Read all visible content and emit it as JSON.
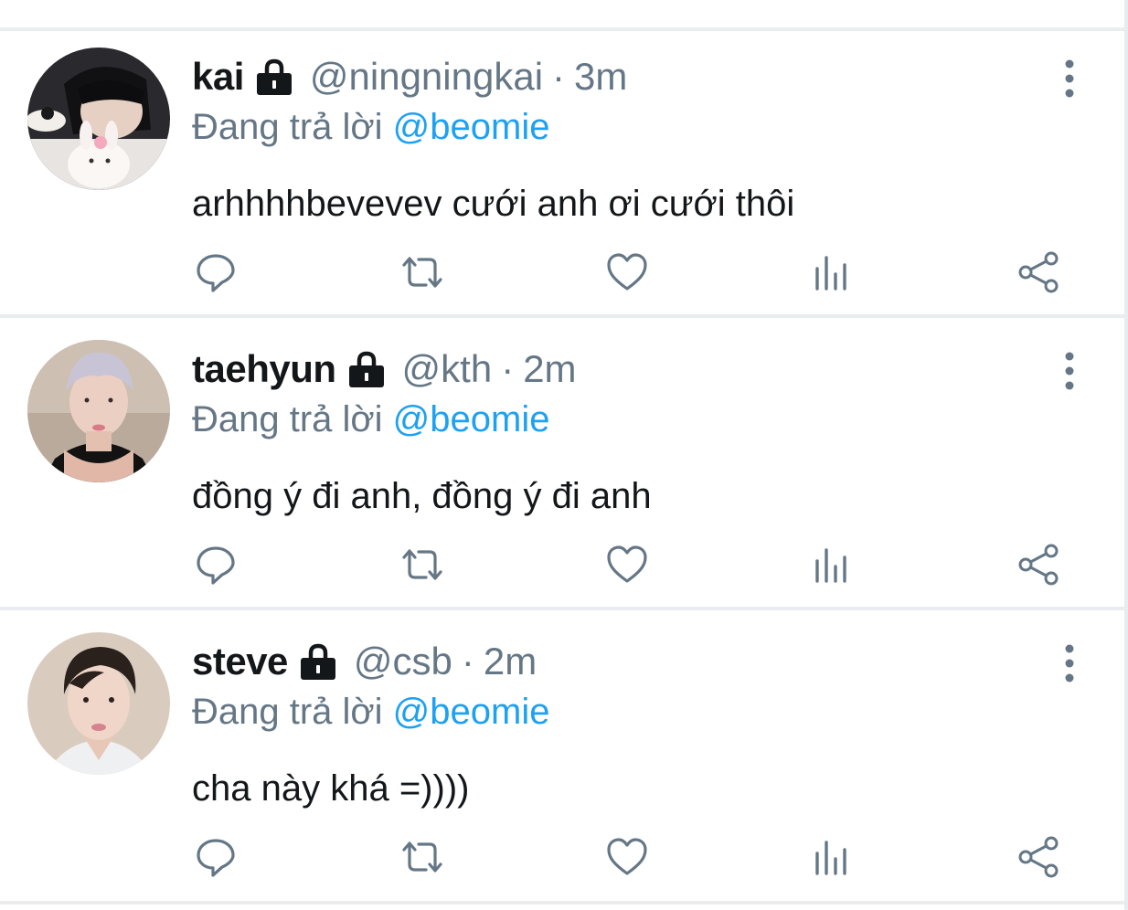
{
  "colors": {
    "text_primary": "#14171a",
    "text_secondary": "#657786",
    "mention": "#1da1f2",
    "divider": "#e9edf0"
  },
  "tweets": [
    {
      "name": "kai",
      "handle": "@ningningkai",
      "separator": "·",
      "time": "3m",
      "reply_prefix": "Đang trả lời",
      "reply_to": "@beomie",
      "text": "arhhhhbevevev cưới anh ơi cưới thôi",
      "protected_icon": "lock-icon",
      "menu_icon": "more-vertical-icon",
      "actions": [
        "reply-icon",
        "retweet-icon",
        "like-icon",
        "analytics-icon",
        "share-icon"
      ]
    },
    {
      "name": "taehyun",
      "handle": "@kth",
      "separator": "·",
      "time": "2m",
      "reply_prefix": "Đang trả lời",
      "reply_to": "@beomie",
      "text": "đồng ý đi anh, đồng ý đi anh",
      "protected_icon": "lock-icon",
      "menu_icon": "more-vertical-icon",
      "actions": [
        "reply-icon",
        "retweet-icon",
        "like-icon",
        "analytics-icon",
        "share-icon"
      ]
    },
    {
      "name": "steve",
      "handle": "@csb",
      "separator": "·",
      "time": "2m",
      "reply_prefix": "Đang trả lời",
      "reply_to": "@beomie",
      "text": "cha này khá =))))",
      "protected_icon": "lock-icon",
      "menu_icon": "more-vertical-icon",
      "actions": [
        "reply-icon",
        "retweet-icon",
        "like-icon",
        "analytics-icon",
        "share-icon"
      ]
    }
  ]
}
